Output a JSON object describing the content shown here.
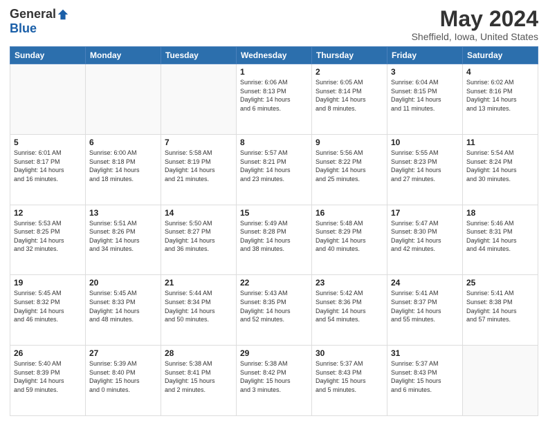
{
  "logo": {
    "general": "General",
    "blue": "Blue"
  },
  "header": {
    "month": "May 2024",
    "location": "Sheffield, Iowa, United States"
  },
  "weekdays": [
    "Sunday",
    "Monday",
    "Tuesday",
    "Wednesday",
    "Thursday",
    "Friday",
    "Saturday"
  ],
  "weeks": [
    [
      {
        "day": "",
        "info": ""
      },
      {
        "day": "",
        "info": ""
      },
      {
        "day": "",
        "info": ""
      },
      {
        "day": "1",
        "info": "Sunrise: 6:06 AM\nSunset: 8:13 PM\nDaylight: 14 hours\nand 6 minutes."
      },
      {
        "day": "2",
        "info": "Sunrise: 6:05 AM\nSunset: 8:14 PM\nDaylight: 14 hours\nand 8 minutes."
      },
      {
        "day": "3",
        "info": "Sunrise: 6:04 AM\nSunset: 8:15 PM\nDaylight: 14 hours\nand 11 minutes."
      },
      {
        "day": "4",
        "info": "Sunrise: 6:02 AM\nSunset: 8:16 PM\nDaylight: 14 hours\nand 13 minutes."
      }
    ],
    [
      {
        "day": "5",
        "info": "Sunrise: 6:01 AM\nSunset: 8:17 PM\nDaylight: 14 hours\nand 16 minutes."
      },
      {
        "day": "6",
        "info": "Sunrise: 6:00 AM\nSunset: 8:18 PM\nDaylight: 14 hours\nand 18 minutes."
      },
      {
        "day": "7",
        "info": "Sunrise: 5:58 AM\nSunset: 8:19 PM\nDaylight: 14 hours\nand 21 minutes."
      },
      {
        "day": "8",
        "info": "Sunrise: 5:57 AM\nSunset: 8:21 PM\nDaylight: 14 hours\nand 23 minutes."
      },
      {
        "day": "9",
        "info": "Sunrise: 5:56 AM\nSunset: 8:22 PM\nDaylight: 14 hours\nand 25 minutes."
      },
      {
        "day": "10",
        "info": "Sunrise: 5:55 AM\nSunset: 8:23 PM\nDaylight: 14 hours\nand 27 minutes."
      },
      {
        "day": "11",
        "info": "Sunrise: 5:54 AM\nSunset: 8:24 PM\nDaylight: 14 hours\nand 30 minutes."
      }
    ],
    [
      {
        "day": "12",
        "info": "Sunrise: 5:53 AM\nSunset: 8:25 PM\nDaylight: 14 hours\nand 32 minutes."
      },
      {
        "day": "13",
        "info": "Sunrise: 5:51 AM\nSunset: 8:26 PM\nDaylight: 14 hours\nand 34 minutes."
      },
      {
        "day": "14",
        "info": "Sunrise: 5:50 AM\nSunset: 8:27 PM\nDaylight: 14 hours\nand 36 minutes."
      },
      {
        "day": "15",
        "info": "Sunrise: 5:49 AM\nSunset: 8:28 PM\nDaylight: 14 hours\nand 38 minutes."
      },
      {
        "day": "16",
        "info": "Sunrise: 5:48 AM\nSunset: 8:29 PM\nDaylight: 14 hours\nand 40 minutes."
      },
      {
        "day": "17",
        "info": "Sunrise: 5:47 AM\nSunset: 8:30 PM\nDaylight: 14 hours\nand 42 minutes."
      },
      {
        "day": "18",
        "info": "Sunrise: 5:46 AM\nSunset: 8:31 PM\nDaylight: 14 hours\nand 44 minutes."
      }
    ],
    [
      {
        "day": "19",
        "info": "Sunrise: 5:45 AM\nSunset: 8:32 PM\nDaylight: 14 hours\nand 46 minutes."
      },
      {
        "day": "20",
        "info": "Sunrise: 5:45 AM\nSunset: 8:33 PM\nDaylight: 14 hours\nand 48 minutes."
      },
      {
        "day": "21",
        "info": "Sunrise: 5:44 AM\nSunset: 8:34 PM\nDaylight: 14 hours\nand 50 minutes."
      },
      {
        "day": "22",
        "info": "Sunrise: 5:43 AM\nSunset: 8:35 PM\nDaylight: 14 hours\nand 52 minutes."
      },
      {
        "day": "23",
        "info": "Sunrise: 5:42 AM\nSunset: 8:36 PM\nDaylight: 14 hours\nand 54 minutes."
      },
      {
        "day": "24",
        "info": "Sunrise: 5:41 AM\nSunset: 8:37 PM\nDaylight: 14 hours\nand 55 minutes."
      },
      {
        "day": "25",
        "info": "Sunrise: 5:41 AM\nSunset: 8:38 PM\nDaylight: 14 hours\nand 57 minutes."
      }
    ],
    [
      {
        "day": "26",
        "info": "Sunrise: 5:40 AM\nSunset: 8:39 PM\nDaylight: 14 hours\nand 59 minutes."
      },
      {
        "day": "27",
        "info": "Sunrise: 5:39 AM\nSunset: 8:40 PM\nDaylight: 15 hours\nand 0 minutes."
      },
      {
        "day": "28",
        "info": "Sunrise: 5:38 AM\nSunset: 8:41 PM\nDaylight: 15 hours\nand 2 minutes."
      },
      {
        "day": "29",
        "info": "Sunrise: 5:38 AM\nSunset: 8:42 PM\nDaylight: 15 hours\nand 3 minutes."
      },
      {
        "day": "30",
        "info": "Sunrise: 5:37 AM\nSunset: 8:43 PM\nDaylight: 15 hours\nand 5 minutes."
      },
      {
        "day": "31",
        "info": "Sunrise: 5:37 AM\nSunset: 8:43 PM\nDaylight: 15 hours\nand 6 minutes."
      },
      {
        "day": "",
        "info": ""
      }
    ]
  ]
}
